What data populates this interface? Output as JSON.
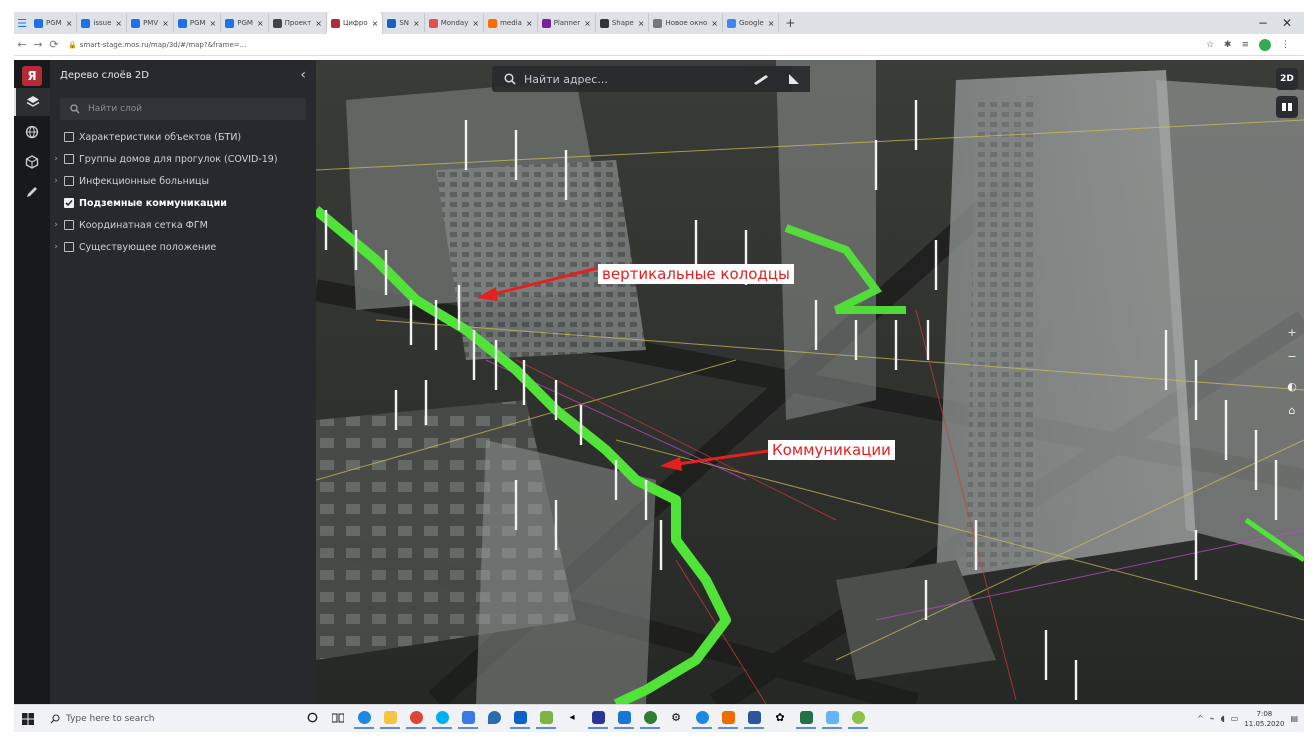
{
  "browser": {
    "tabs": [
      {
        "label": "PGM",
        "color": "#1a73e8"
      },
      {
        "label": "issue",
        "color": "#1a73e8"
      },
      {
        "label": "PMV",
        "color": "#1a73e8"
      },
      {
        "label": "PGM",
        "color": "#1a73e8"
      },
      {
        "label": "PGM",
        "color": "#1a73e8"
      },
      {
        "label": "Проект",
        "color": "#444444"
      },
      {
        "label": "Цифро",
        "color": "#b32a3a",
        "active": true
      },
      {
        "label": "SN",
        "color": "#1565c0"
      },
      {
        "label": "Monday",
        "color": "#e34f4f"
      },
      {
        "label": "media",
        "color": "#ff6d00"
      },
      {
        "label": "Planner",
        "color": "#7b1fa2"
      },
      {
        "label": "Shape",
        "color": "#333333"
      },
      {
        "label": "Новое окно",
        "color": "#777777"
      },
      {
        "label": "Google",
        "color": "#4285f4"
      }
    ],
    "url": "smart-stage.mos.ru/map/3d/#/map?&frame=..."
  },
  "sidebar": {
    "title": "Дерево слоёв 2D",
    "search_placeholder": "Найти слой",
    "layers": [
      {
        "label": "Характеристики объектов (БТИ)",
        "expandable": false,
        "checked": false
      },
      {
        "label": "Группы домов для прогулок (COVID-19)",
        "expandable": true,
        "checked": false
      },
      {
        "label": "Инфекционные больницы",
        "expandable": true,
        "checked": false
      },
      {
        "label": "Подземные коммуникации",
        "expandable": false,
        "checked": true
      },
      {
        "label": "Координатная сетка ФГМ",
        "expandable": true,
        "checked": false
      },
      {
        "label": "Существующее положение",
        "expandable": true,
        "checked": false
      }
    ]
  },
  "map": {
    "search_placeholder": "Найти адрес...",
    "view_mode": "2D",
    "annotations": {
      "wells": "вертикальные колодцы",
      "communications": "Коммуникации"
    },
    "utility_color": "#52e33a",
    "annotation_color": "#e42020"
  },
  "taskbar": {
    "search_placeholder": "Type here to search",
    "time": "7:08",
    "date": "11.05.2020"
  }
}
